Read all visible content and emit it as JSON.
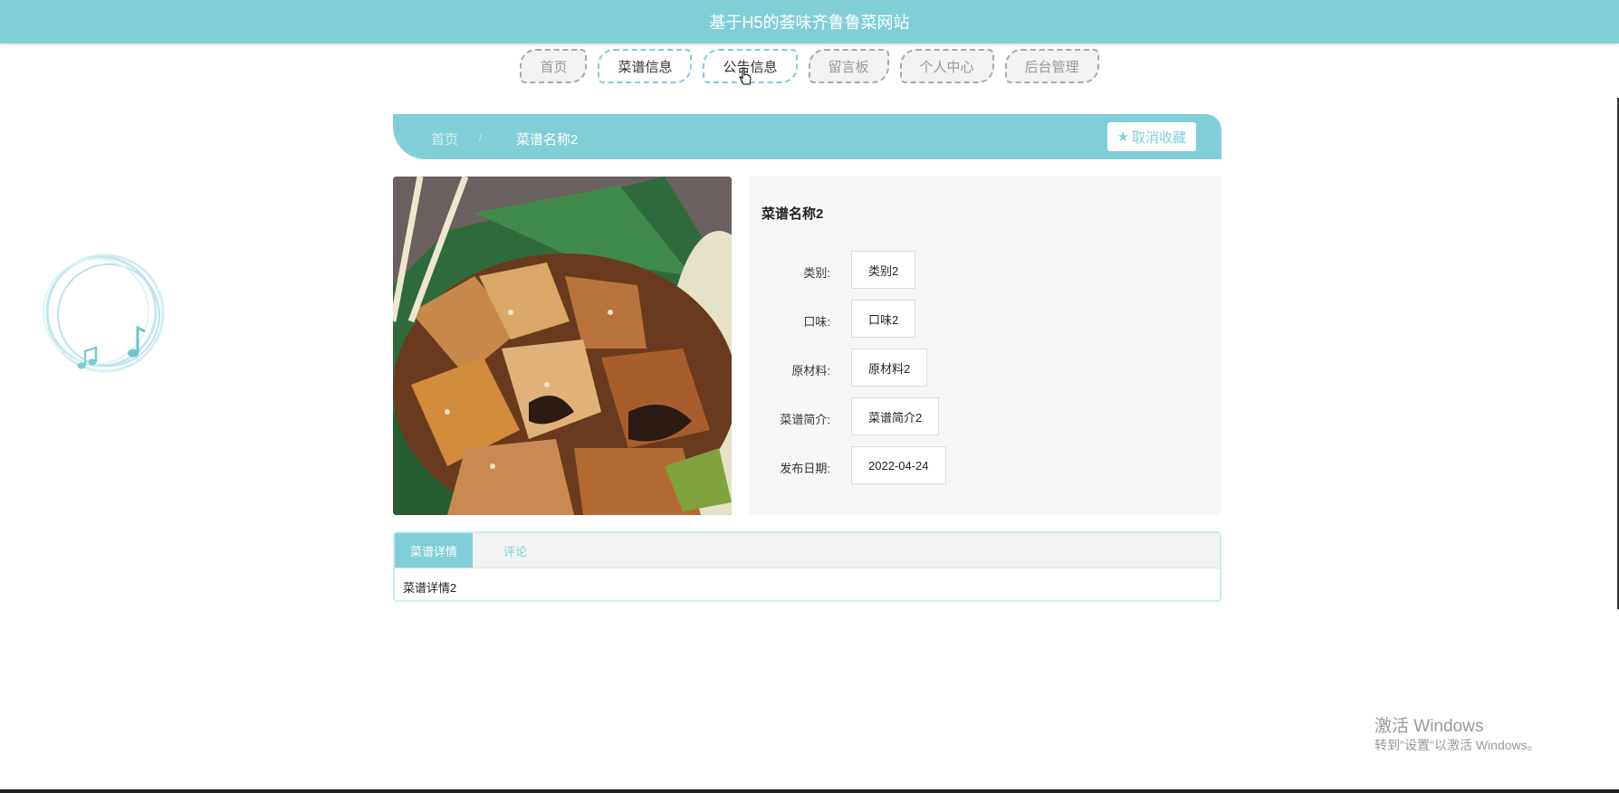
{
  "header": {
    "title": "基于H5的荟味齐鲁鲁菜网站"
  },
  "nav": {
    "items": [
      {
        "label": "首页"
      },
      {
        "label": "菜谱信息"
      },
      {
        "label": "公告信息"
      },
      {
        "label": "留言板"
      },
      {
        "label": "个人中心"
      },
      {
        "label": "后台管理"
      }
    ]
  },
  "breadcrumb": {
    "home": "首页",
    "separator": "/",
    "current": "菜谱名称2",
    "favorite_button": "取消收藏"
  },
  "recipe": {
    "name": "菜谱名称2",
    "fields": [
      {
        "label": "类别:",
        "value": "类别2"
      },
      {
        "label": "口味:",
        "value": "口味2"
      },
      {
        "label": "原材料:",
        "value": "原材料2"
      },
      {
        "label": "菜谱简介:",
        "value": "菜谱简介2"
      },
      {
        "label": "发布日期:",
        "value": "2022-04-24"
      }
    ]
  },
  "tabs": {
    "items": [
      {
        "label": "菜谱详情"
      },
      {
        "label": "评论"
      }
    ],
    "content": "菜谱详情2"
  },
  "watermark": {
    "title": "激活 Windows",
    "subtitle": "转到\"设置\"以激活 Windows。"
  },
  "colors": {
    "accent": "#80cfd8",
    "background": "#ffffff",
    "panel": "#f7f7f7"
  },
  "icons": {
    "favorite": "star-icon",
    "music": "music-note-icon",
    "cursor": "hand-cursor-icon"
  }
}
